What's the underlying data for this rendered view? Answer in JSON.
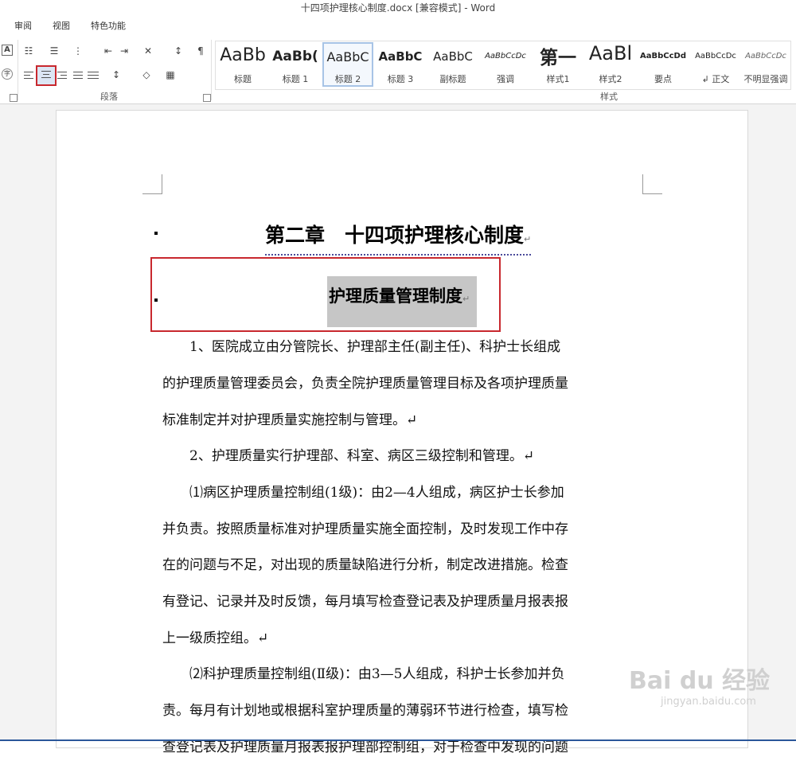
{
  "window": {
    "title": "十四项护理核心制度.docx [兼容模式] - Word"
  },
  "menu": {
    "items": [
      "审阅",
      "视图",
      "特色功能"
    ]
  },
  "ribbon": {
    "groups": {
      "paragraph": "段落",
      "styles": "样式"
    },
    "styles": [
      {
        "preview": "AaBb",
        "name": "标题"
      },
      {
        "preview": "AaBb(",
        "name": "标题 1"
      },
      {
        "preview": "AaBbC",
        "name": "标题 2",
        "selected": true
      },
      {
        "preview": "AaBbC",
        "name": "标题 3"
      },
      {
        "preview": "AaBbC",
        "name": "副标题"
      },
      {
        "preview": "AaBbCcDc",
        "name": "强调"
      },
      {
        "preview": "第一",
        "name": "样式1"
      },
      {
        "preview": "AaBl",
        "name": "样式2"
      },
      {
        "preview": "AaBbCcDd",
        "name": "要点"
      },
      {
        "preview": "AaBbCcDc",
        "name": "↲ 正文"
      },
      {
        "preview": "AaBbCcDc",
        "name": "不明显强调"
      }
    ],
    "icons": [
      "text-box-icon",
      "phonetic-guide-icon",
      "bullets-icon",
      "numbering-icon",
      "multilevel-list-icon",
      "decrease-indent-icon",
      "increase-indent-icon",
      "chinese-layout-icon",
      "sort-icon",
      "show-marks-icon",
      "align-left-icon",
      "align-center-icon",
      "align-right-icon",
      "justify-icon",
      "distributed-icon",
      "line-spacing-icon",
      "shading-icon",
      "borders-icon"
    ]
  },
  "document": {
    "heading1": "第二章　十四项护理核心制度",
    "heading2": "护理质量管理制度",
    "paragraph_mark": "↵",
    "lines": [
      "　　1、医院成立由分管院长、护理部主任(副主任)、科护士长组成",
      "的护理质量管理委员会，负责全院护理质量管理目标及各项护理质量",
      "标准制定并对护理质量实施控制与管理。↵",
      "　　2、护理质量实行护理部、科室、病区三级控制和管理。↵",
      "　　⑴病区护理质量控制组(1级)：由2—4人组成，病区护士长参加",
      "并负责。按照质量标准对护理质量实施全面控制，及时发现工作中存",
      "在的问题与不足，对出现的质量缺陷进行分析，制定改进措施。检查",
      "有登记、记录并及时反馈，每月填写检查登记表及护理质量月报表报",
      "上一级质控组。↵",
      "　　⑵科护理质量控制组(Ⅱ级)：由3—5人组成，科护士长参加并负",
      "责。每月有计划地或根据科室护理质量的薄弱环节进行检查，填写检",
      "查登记表及护理质量月报表报护理部控制组，对于检查中发现的问题"
    ]
  },
  "watermark": {
    "brand": "Bai du 经验",
    "url": "jingyan.baidu.com"
  }
}
